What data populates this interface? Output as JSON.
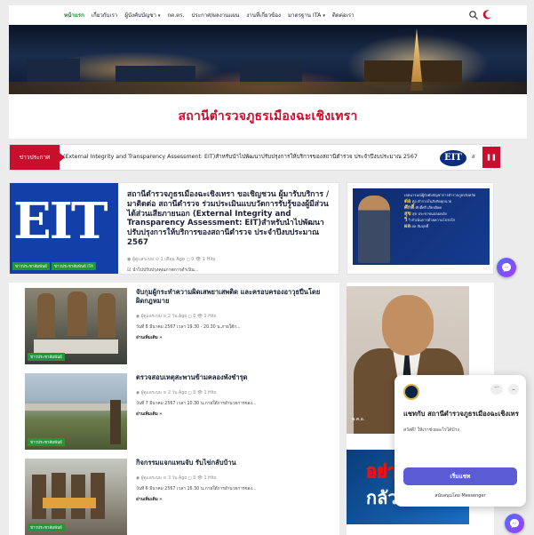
{
  "nav": {
    "items": [
      {
        "label": "หน้าแรก",
        "active": true
      },
      {
        "label": "เกี่ยวกับเรา"
      },
      {
        "label": "ผู้บังคับบัญชา",
        "caret": true
      },
      {
        "label": "กต.ตร."
      },
      {
        "label": "ประกาศ/ผลงานแผน"
      },
      {
        "label": "งานที่เกี่ยวข้อง"
      },
      {
        "label": "มาตรฐาน ITA",
        "caret": true
      },
      {
        "label": "ติดต่อเรา"
      }
    ],
    "search_icon": "search-icon",
    "theme_icon": "moon-icon"
  },
  "site_title": "สถานีตำรวจภูธรเมืองฉะเชิงเทรา",
  "ticker": {
    "label": "ข่าวประกาศ",
    "text": "(External Integrity and Transparency Assessment: EIT)สำหรับนำไปพัฒนาปรับปรุงการให้บริการของสถานีตำรวจ ประจำปีงบประมาณ 2567",
    "badge": "EIT",
    "tail": "ส",
    "pause_icon": "pause-icon"
  },
  "featured": {
    "thumb_text": "EIT",
    "tags": [
      "ข่าวประชาสัมพันธ์",
      "ข่าวประชาสัมพันธ์ ITA"
    ],
    "title": "สถานีตำรวจภูธรเมืองฉะเชิงเทรา ขอเชิญชวน ผู้มารับบริการ / มาติดต่อ สถานีตำรวจ ร่วมประเมินแบบวัดการรับรู้ของผู้มีส่วนได้ส่วนเสียภายนอก (External Integrity and Transparency Assessment: EIT)สำหรับนำไปพัฒนาปรับปรุงการให้บริการของสถานีตำรวจ ประจำปีงบประมาณ 2567",
    "meta": "◉ ผู้ดูแลระบบ  ⊙ 1 เดือน Ago  ◻ 0  👁 1 Hits",
    "excerpt": "☑ นำไปปรับปรุงคุณภาพการดำเนิน..."
  },
  "side_banner": {
    "lines": [
      {
        "word": "",
        "text": "เจตนารมณ์ผู้บังคับบัญชาการตำรวจภูธรจังหวัด"
      },
      {
        "word": "ต่อ",
        "text": "ต่อ ตำรวจในสังกัดทุกนาย"
      },
      {
        "word": "ศักดิ์",
        "text": "ศักดิ์ศรี เกียรติยศ"
      },
      {
        "word": "สุข",
        "text": "สุข ประชาชนปลอดภัย"
      },
      {
        "word": "วิ",
        "text": "วิ ดำเนินการด้วยความโปร่งใส"
      },
      {
        "word": "ผล",
        "text": "ผล สัมฤทธิ์"
      }
    ]
  },
  "posts": [
    {
      "title": "จับกุมผู้กระทำความผิดเสพยาเสพติด และครอบครองอาวุธปืนโดยผิดกฎหมาย",
      "meta": "◉ ผู้ดูแลระบบ  ⊙ 2 วัน Ago  ◻ 0  👁 1 Hits",
      "excerpt": "วันที่ 8 มีนาคม 2567 เวลา 19.30 - 20.30 น.ภายใต้ก...",
      "read_more": "อ่านเพิ่มเติม »",
      "tag": "ข่าวประชาสัมพันธ์"
    },
    {
      "title": "ตรวจสอบเหตุสะพานข้ามคลองพังชำรุด",
      "meta": "◉ ผู้ดูแลระบบ  ⊙ 2 วัน Ago  ◻ 0  👁 1 Hits",
      "excerpt": "วันที่ 7 มีนาคม 2567 เวลา 10.30 น.ภายใต้การอำนวยการของ...",
      "read_more": "อ่านเพิ่มเติม »",
      "tag": "ข่าวประชาสัมพันธ์"
    },
    {
      "title": "กิจกรรมแจกแทนจับ รับไข่กลับบ้าน",
      "meta": "◉ ผู้ดูแลระบบ  ⊙ 3 วัน Ago  ◻ 0  👁 1 Hits",
      "excerpt": "วันที่ 6 มีนาคม 2567 เวลา 16.30 น.ภายใต้การอำนวยการของ...",
      "read_more": "อ่านเพิ่มเติม »",
      "tag": "ข่าวประชาสัมพันธ์"
    }
  ],
  "portrait_caption": "พ.ต.อ.",
  "poster": {
    "line1": "อย่า",
    "line2": "กลัว"
  },
  "chat": {
    "title": "แชทกับ สถานีตำรวจภูธรเมืองฉะเชิงเทรา",
    "greeting": "สวัสดี! ให้เราช่วยอะไรได้บ้าง",
    "start_button": "เริ่มแชท",
    "powered": "สนับสนุนโดย Messenger"
  },
  "colors": {
    "brand_red": "#c8102e",
    "tag_green": "#1c9a36",
    "nav_active": "#1a8a2e",
    "chat_button": "#5b5bd6"
  }
}
